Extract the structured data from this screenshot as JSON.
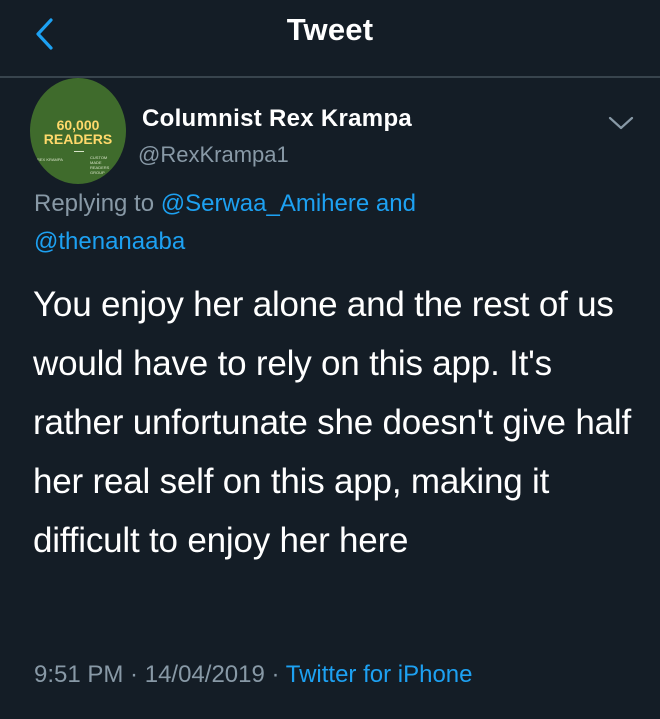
{
  "header": {
    "title": "Tweet"
  },
  "author": {
    "display_name": "Columnist Rex Krampa",
    "handle": "@RexKrampa1",
    "avatar": {
      "top_text": "60,000",
      "main_text": "READERS",
      "small_left": "REX KRAMPA",
      "small_right": "CUSTOM MADE READERS GROUP"
    }
  },
  "reply": {
    "prefix": "Replying to ",
    "user1": "@Serwaa_Amihere",
    "and": " and",
    "user2": "@thenanaaba"
  },
  "tweet": {
    "text": "You enjoy her alone and the rest of us would have to rely on this app. It's rather unfortunate she doesn't give half her real self on this app, making it difficult to enjoy her here"
  },
  "meta": {
    "time": "9:51 PM",
    "sep1": " · ",
    "date": "14/04/2019",
    "sep2": " · ",
    "source": "Twitter for iPhone"
  },
  "icons": {
    "back": "chevron-left-icon",
    "caret": "chevron-down-icon"
  },
  "colors": {
    "background": "#141d26",
    "link": "#1da1f2",
    "secondary_text": "#8899a6",
    "divider": "#38444d"
  }
}
